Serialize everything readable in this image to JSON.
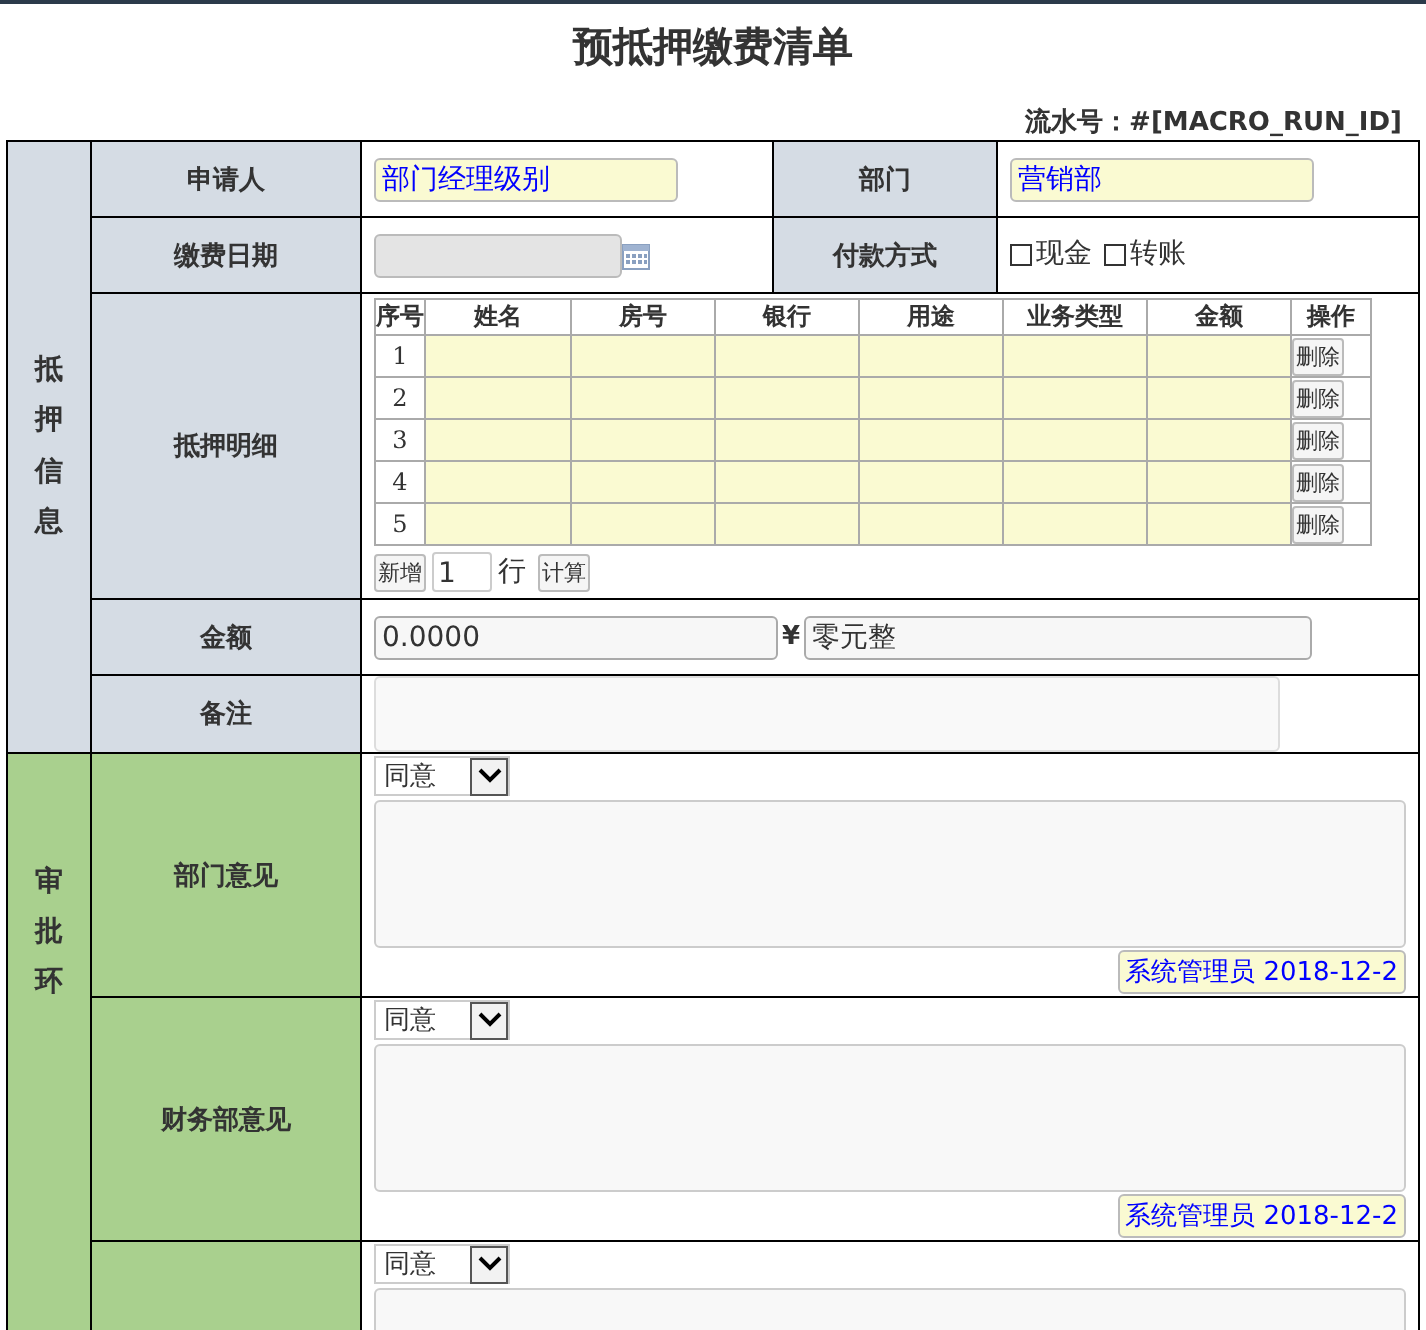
{
  "title": "预抵押缴费清单",
  "serial": "流水号：#[MACRO_RUN_ID]",
  "info_section": {
    "label": "抵押信息",
    "applicant": {
      "label": "申请人",
      "value": "部门经理级别"
    },
    "department": {
      "label": "部门",
      "value": "营销部"
    },
    "payment_date": {
      "label": "缴费日期"
    },
    "payment_method": {
      "label": "付款方式",
      "options": [
        {
          "label": "现金",
          "checked": false
        },
        {
          "label": "转账",
          "checked": false
        }
      ]
    },
    "details": {
      "label": "抵押明细",
      "columns": [
        "序号",
        "姓名",
        "房号",
        "银行",
        "用途",
        "业务类型",
        "金额",
        "操作"
      ],
      "rows": [
        {
          "index": "1",
          "action": "删除"
        },
        {
          "index": "2",
          "action": "删除"
        },
        {
          "index": "3",
          "action": "删除"
        },
        {
          "index": "4",
          "action": "删除"
        },
        {
          "index": "5",
          "action": "删除"
        }
      ],
      "add_button": "新增",
      "row_count": "1",
      "row_unit": "行",
      "calc_button": "计算"
    },
    "amount": {
      "label": "金额",
      "value": "0.0000",
      "currency": "¥",
      "words": "零元整"
    },
    "remark": {
      "label": "备注"
    }
  },
  "approval_section": {
    "label": "审批环",
    "opinions": [
      {
        "label": "部门意见",
        "choice": "同意",
        "signature": "系统管理员 2018-12-2"
      },
      {
        "label": "财务部意见",
        "choice": "同意",
        "signature": "系统管理员 2018-12-2"
      },
      {
        "choice": "同意"
      }
    ]
  }
}
